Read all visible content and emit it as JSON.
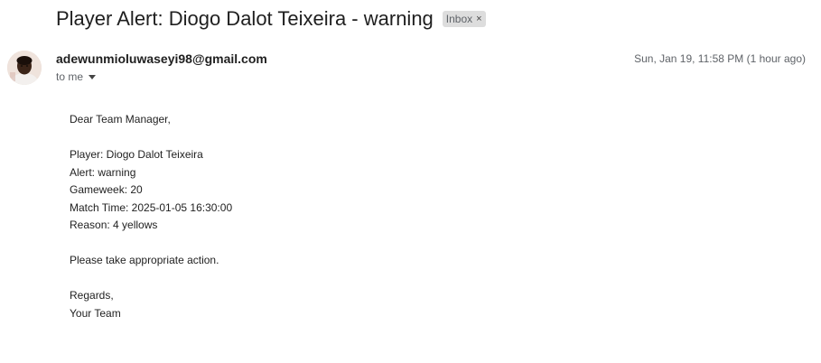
{
  "email": {
    "subject": "Player Alert: Diogo Dalot Teixeira - warning",
    "label": "Inbox",
    "label_close_glyph": "×",
    "sender": "adewunmioluwaseyi98@gmail.com",
    "recipient_line": "to me",
    "date": "Sun, Jan 19, 11:58 PM (1 hour ago)",
    "body": {
      "greeting": "Dear Team Manager,",
      "player": "Player: Diogo Dalot Teixeira",
      "alert": "Alert: warning",
      "gameweek": "Gameweek: 20",
      "match_time": "Match Time: 2025-01-05 16:30:00",
      "reason": "Reason: 4 yellows",
      "request": "Please take appropriate action.",
      "closing": "Regards,",
      "signature": "Your Team"
    }
  },
  "icons": {
    "avatar": "sender-avatar-photo",
    "recipient_toggle": "chevron-down-icon",
    "label_remove": "close-icon"
  },
  "colors": {
    "label_chip_bg": "#dddddd",
    "secondary_text": "#5f6368"
  }
}
